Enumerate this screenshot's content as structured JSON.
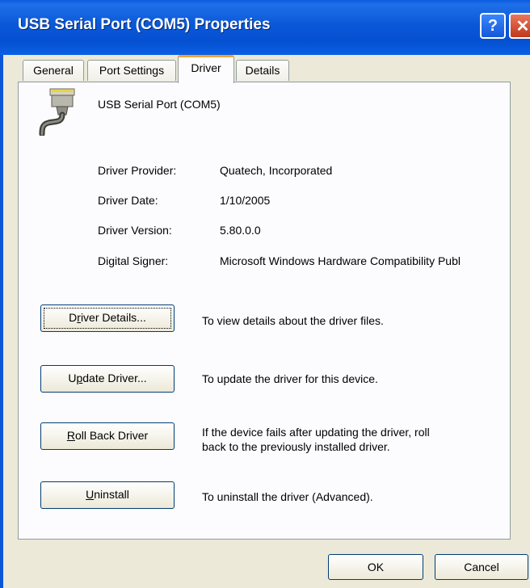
{
  "window": {
    "title": "USB Serial Port (COM5) Properties",
    "help_glyph": "?",
    "close_glyph": "✕",
    "accent": "#0a58d8"
  },
  "tabs": [
    {
      "label": "General"
    },
    {
      "label": "Port Settings"
    },
    {
      "label": "Driver",
      "active": true
    },
    {
      "label": "Details"
    }
  ],
  "device": {
    "name": "USB Serial Port (COM5)",
    "icon": "serial-port-connector-icon"
  },
  "driver_info": {
    "provider_label": "Driver Provider:",
    "provider_value": "Quatech, Incorporated",
    "date_label": "Driver Date:",
    "date_value": "1/10/2005",
    "version_label": "Driver Version:",
    "version_value": "5.80.0.0",
    "signer_label": "Digital Signer:",
    "signer_value": "Microsoft Windows Hardware Compatibility Publ"
  },
  "actions": {
    "details_pre": "D",
    "details_acc": "r",
    "details_post": "iver Details...",
    "details_desc": "To view details about the driver files.",
    "update_pre": "U",
    "update_acc": "p",
    "update_post": "date Driver...",
    "update_desc": "To update the driver for this device.",
    "rollback_pre": "",
    "rollback_acc": "R",
    "rollback_post": "oll Back Driver",
    "rollback_desc_1": "If the device fails after updating the driver, roll",
    "rollback_desc_2": "back to the previously installed driver.",
    "uninstall_pre": "",
    "uninstall_acc": "U",
    "uninstall_post": "ninstall",
    "uninstall_desc": "To uninstall the driver (Advanced)."
  },
  "footer": {
    "ok_label": "OK",
    "cancel_label": "Cancel"
  }
}
